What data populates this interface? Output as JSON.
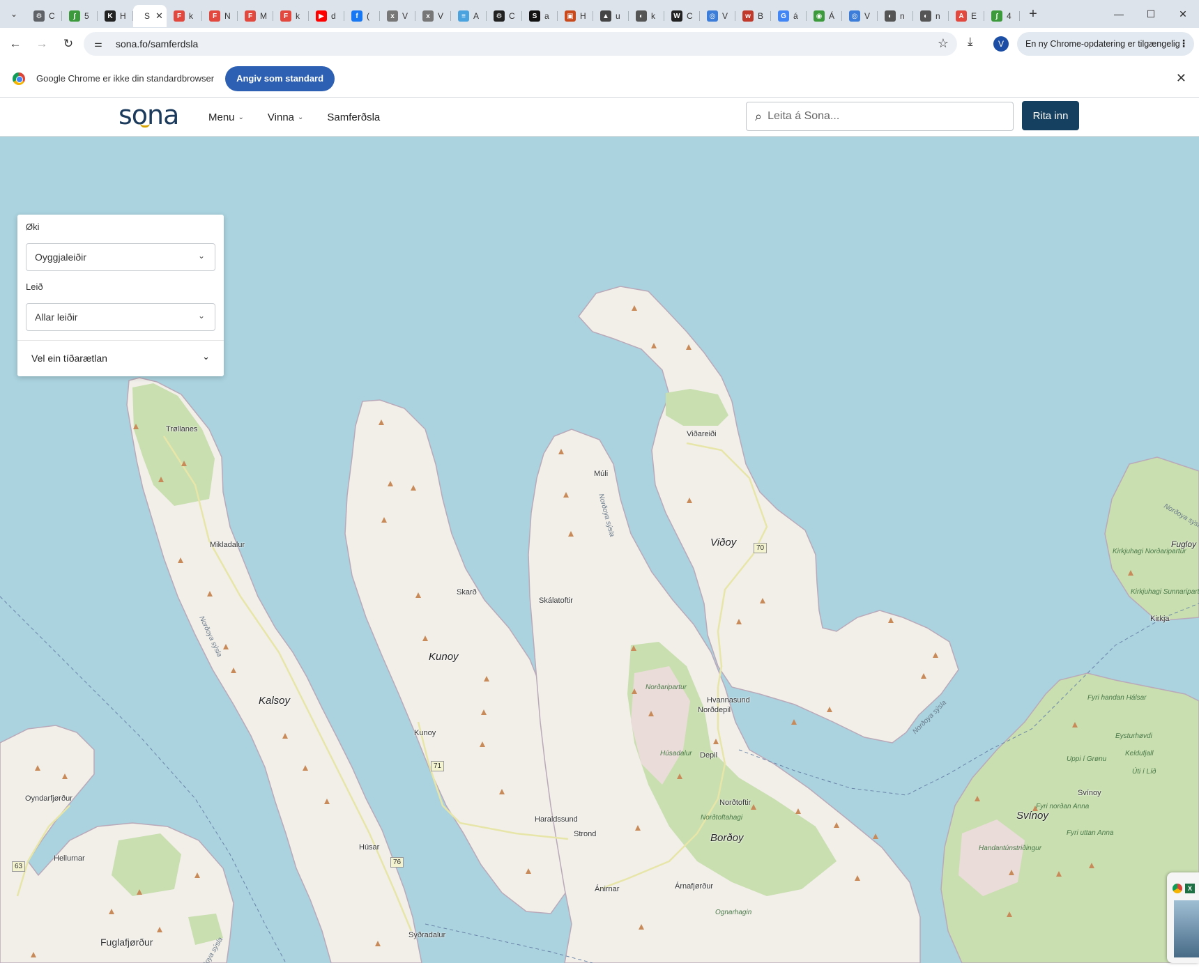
{
  "browser": {
    "tabs": [
      {
        "initial": "C",
        "color": "#5f6368",
        "glyph": "⚙"
      },
      {
        "initial": "5",
        "color": "#3c9a3c",
        "glyph": "∫"
      },
      {
        "initial": "H",
        "color": "#222222",
        "glyph": "K"
      },
      {
        "initial": "S",
        "color": "#ffffff",
        "glyph": "",
        "active": true
      },
      {
        "initial": "k",
        "color": "#e2483d",
        "glyph": "F"
      },
      {
        "initial": "N",
        "color": "#e2483d",
        "glyph": "F"
      },
      {
        "initial": "M",
        "color": "#e2483d",
        "glyph": "F"
      },
      {
        "initial": "k",
        "color": "#e2483d",
        "glyph": "F"
      },
      {
        "initial": "d",
        "color": "#ff0000",
        "glyph": "▶"
      },
      {
        "initial": "(",
        "color": "#1877f2",
        "glyph": "f"
      },
      {
        "initial": "V",
        "color": "#777777",
        "glyph": "x"
      },
      {
        "initial": "V",
        "color": "#777777",
        "glyph": "x"
      },
      {
        "initial": "A",
        "color": "#4aa3df",
        "glyph": "≡"
      },
      {
        "initial": "C",
        "color": "#222222",
        "glyph": "⚙"
      },
      {
        "initial": "a",
        "color": "#111111",
        "glyph": "S"
      },
      {
        "initial": "H",
        "color": "#c84a1c",
        "glyph": "▣"
      },
      {
        "initial": "u",
        "color": "#444444",
        "glyph": "▲"
      },
      {
        "initial": "k",
        "color": "#555555",
        "glyph": "◐"
      },
      {
        "initial": "C",
        "color": "#222222",
        "glyph": "W"
      },
      {
        "initial": "V",
        "color": "#3b7dd8",
        "glyph": "◎"
      },
      {
        "initial": "B",
        "color": "#c0392b",
        "glyph": "w"
      },
      {
        "initial": "á",
        "color": "#4285f4",
        "glyph": "G"
      },
      {
        "initial": "Á",
        "color": "#3c9a3c",
        "glyph": "◉"
      },
      {
        "initial": "V",
        "color": "#3b7dd8",
        "glyph": "◎"
      },
      {
        "initial": "n",
        "color": "#555555",
        "glyph": "◐"
      },
      {
        "initial": "n",
        "color": "#555555",
        "glyph": "◐"
      },
      {
        "initial": "E",
        "color": "#e2483d",
        "glyph": "A"
      },
      {
        "initial": "4",
        "color": "#3c9a3c",
        "glyph": "∫"
      }
    ],
    "url": "sona.fo/samferdsla",
    "profile_initial": "V",
    "update_label": "En ny Chrome-opdatering er tilgængelig"
  },
  "infobar": {
    "message": "Google Chrome er ikke din standardbrowser",
    "button": "Angiv som standard"
  },
  "site": {
    "logo": "sona",
    "nav": [
      {
        "label": "Menu",
        "dropdown": true
      },
      {
        "label": "Vinna",
        "dropdown": true
      },
      {
        "label": "Samferðsla",
        "dropdown": false
      }
    ],
    "search_placeholder": "Leita á Sona...",
    "login_label": "Rita inn"
  },
  "filter_panel": {
    "area_label": "Øki",
    "area_value": "Oyggjaleiðir",
    "route_label": "Leið",
    "route_value": "Allar leiðir",
    "timetable_label": "Vel ein tíðarætlan"
  },
  "map": {
    "colors": {
      "sea": "#aad3df",
      "land": "#f2efe9",
      "green": "#c9dfb0",
      "farmland": "#eadcd8"
    },
    "island_names": [
      "Viðoy",
      "Kunoy",
      "Kalsoy",
      "Borðoy",
      "Svínoy",
      "Fugloy"
    ],
    "places": [
      "Trøllanes",
      "Mikladalur",
      "Viðareiði",
      "Múli",
      "Skarð",
      "Skálatoftir",
      "Kunoy",
      "Hvannasund",
      "Norðdepil",
      "Depil",
      "Norðtoftir",
      "Haraldssund",
      "Strond",
      "Ánirnar",
      "Árnafjørður",
      "Húsar",
      "Syðradalur",
      "Oyndarfjørður",
      "Hellurnar",
      "Fuglafjørður",
      "Svínoy",
      "Kirkja"
    ],
    "region_labels": [
      "Norðoya sýsla",
      "Norðoya sýsla",
      "Norðoya sýsla",
      "Norðoya sýsla",
      "Norðoya sýsla"
    ],
    "green_labels": [
      "Norðaripartur",
      "Húsadalur",
      "Norðtoftahagi",
      "Ognarhagin",
      "Fyri handan Hálsar",
      "Eysturhøvdi",
      "Uppi í Grønu",
      "Keldufjall",
      "Úti í Líð",
      "Fyri norðan Anna",
      "Fyri uttan Anna",
      "Handantúnstriðingur",
      "Kirkjuhagi Norðaripartur",
      "Kirkjuhagi Sunnaripartur"
    ],
    "road_numbers": [
      "70",
      "71",
      "76",
      "63"
    ]
  }
}
